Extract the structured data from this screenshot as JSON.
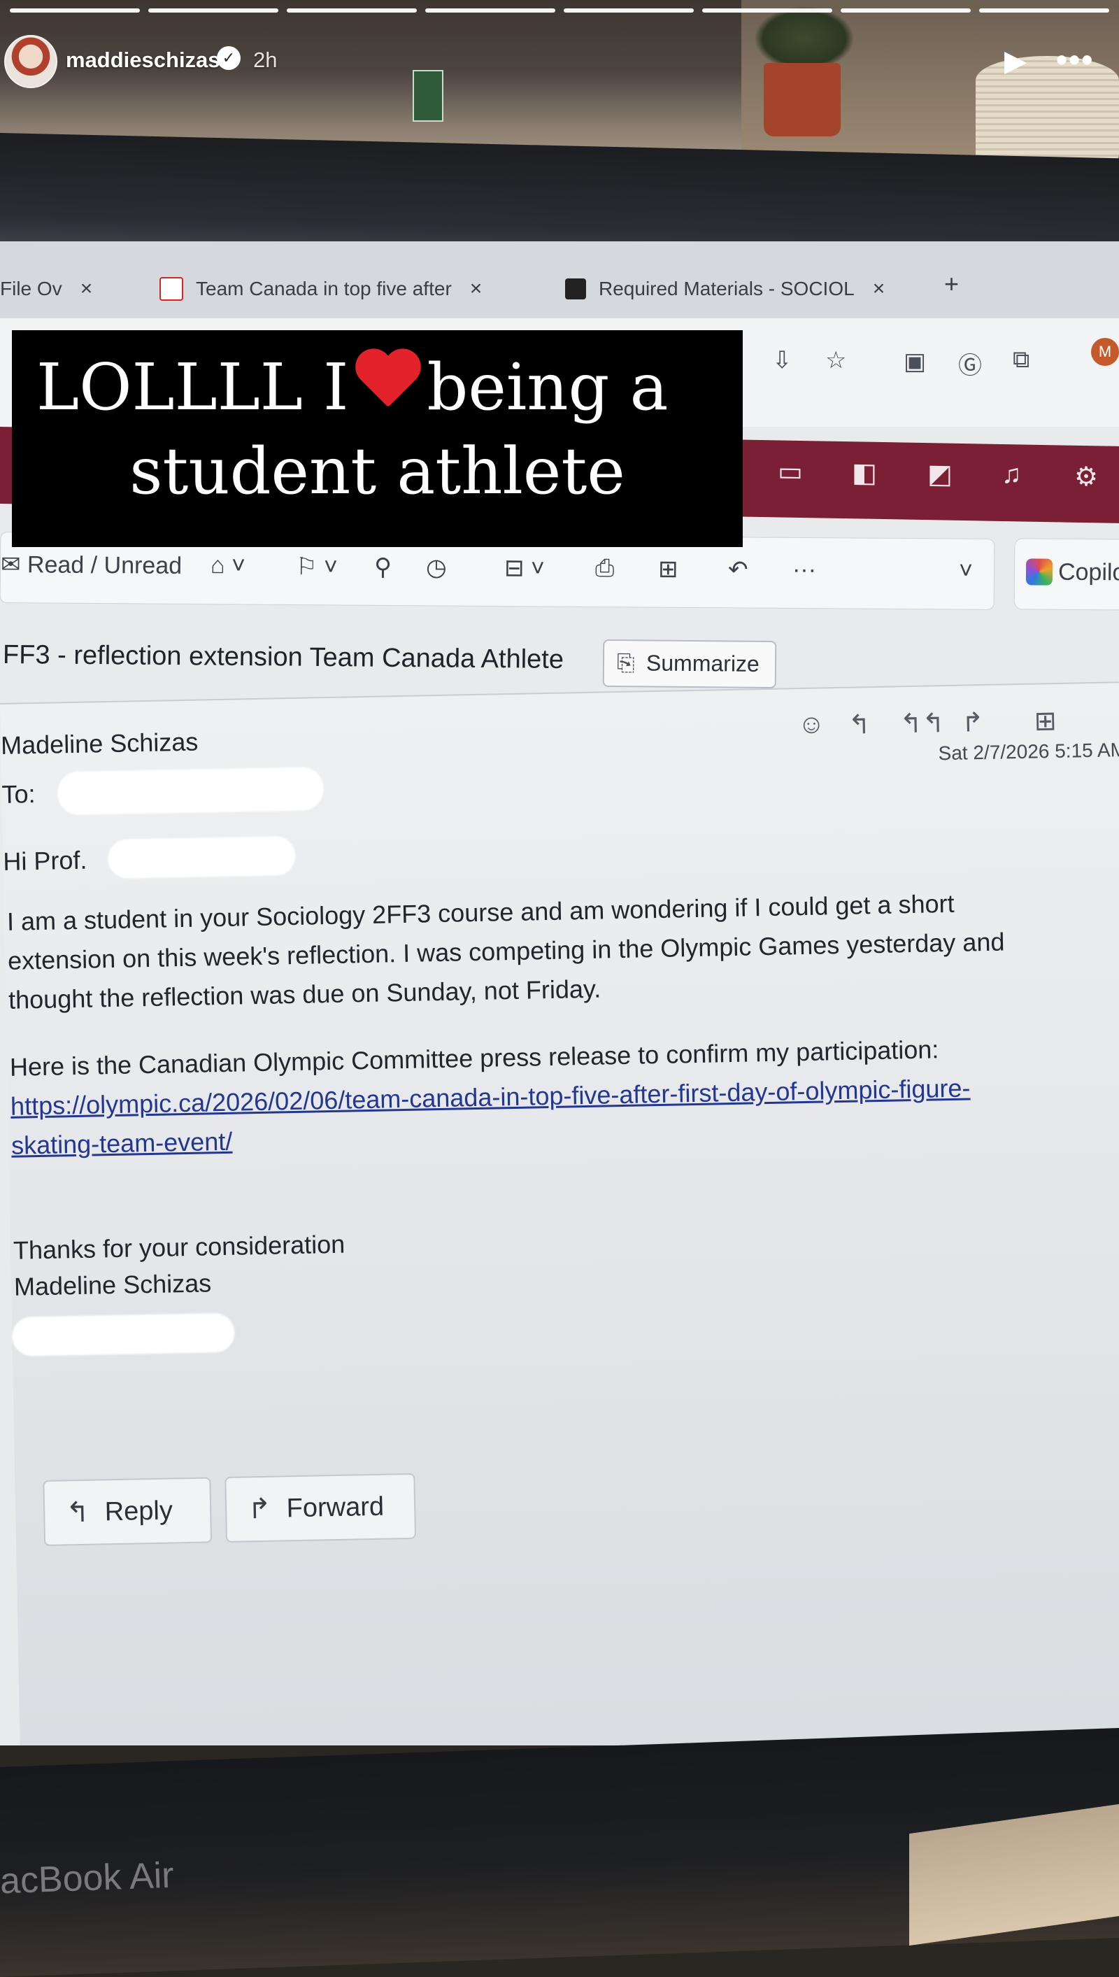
{
  "story": {
    "username": "maddieschizas",
    "time": "2h",
    "caption_line1_before": "LOLLLL I",
    "caption_line1_after": "being a",
    "caption_line2": "student athlete"
  },
  "browser": {
    "tabs": [
      {
        "label": "File Ov"
      },
      {
        "label": "Team Canada in top five after"
      },
      {
        "label": "Required Materials - SOCIOL"
      }
    ],
    "new_tab": "+",
    "tab_close": "×",
    "profile_initial": "M"
  },
  "ribbon": {
    "read_unread": "Read / Unread",
    "more": "···",
    "copilot": "Copilo"
  },
  "email": {
    "subject": "FF3 - reflection extension Team Canada Athlete",
    "summarize": "Summarize",
    "sender": "Madeline Schizas",
    "to_label": "To:",
    "date": "Sat 2/7/2026 5:15 AM",
    "greeting": "Hi Prof.",
    "body_line1": "I am a student in your Sociology 2FF3 course and am wondering if I could get a short",
    "body_line2": "extension on this week's reflection. I was competing in the Olympic Games yesterday and",
    "body_line3": "thought the reflection was due on Sunday, not Friday.",
    "body_line4": "Here is the Canadian Olympic Committee press release to confirm my participation:",
    "link_line1": "https://olympic.ca/2026/02/06/team-canada-in-top-five-after-first-day-of-olympic-figure-",
    "link_line2": "skating-team-event/",
    "closing": "Thanks for your consideration",
    "signature": "Madeline Schizas",
    "reply": "Reply",
    "forward": "Forward"
  },
  "device": {
    "label": "acBook Air"
  }
}
